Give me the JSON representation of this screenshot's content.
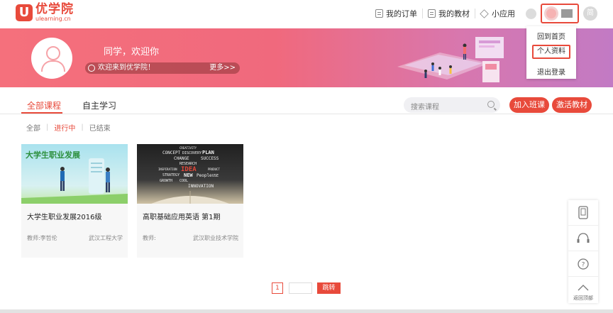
{
  "brand": {
    "cn": "优学院",
    "en": "ulearning.cn",
    "mark": "U"
  },
  "nav": {
    "orders": "我的订单",
    "textbooks": "我的教材",
    "apps": "小应用",
    "jian": "简"
  },
  "dropdown": {
    "items": [
      "回到首页",
      "个人资料",
      "退出登录"
    ]
  },
  "banner": {
    "greeting": "同学，欢迎你",
    "welcome": "欢迎来到优学院！",
    "more": "更多>>"
  },
  "tabs": {
    "all_courses": "全部课程",
    "self_study": "自主学习"
  },
  "search": {
    "placeholder": "搜索课程"
  },
  "buttons": {
    "join_class": "加入班课",
    "activate_textbook": "激活教材"
  },
  "filters": {
    "all": "全部",
    "in_progress": "进行中",
    "ended": "已结束"
  },
  "courses": [
    {
      "title": "大学生职业发展2016级",
      "teacher": "教师:李哲伦",
      "school": "武汉工程大学",
      "cover_text": "大学生职业发展"
    },
    {
      "title": "高职基础应用英语 第1期",
      "teacher": "教师:",
      "school": "武汉职业技术学院",
      "cover_words": [
        "CREATIVITY",
        "CONCEPT",
        "DISCOVERY",
        "PLAN",
        "CHANGE",
        "SUCCESS",
        "RESEARCH",
        "INSPIRATION",
        "IDEA",
        "PRODUCT",
        "STRATEGY",
        "NEW",
        "People",
        "USE",
        "GROWTH",
        "COOL",
        "INNOVATION"
      ]
    }
  ],
  "pagination": {
    "current": "1",
    "go": "跳转"
  },
  "sidebar": {
    "back_to_top": "返回顶部"
  }
}
